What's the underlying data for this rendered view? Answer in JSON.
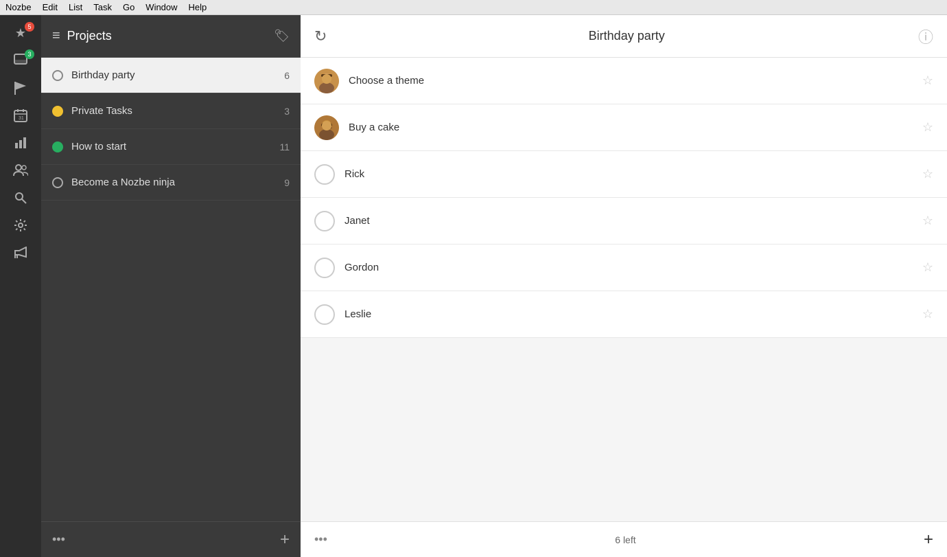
{
  "menubar": {
    "items": [
      "Nozbe",
      "Edit",
      "List",
      "Task",
      "Go",
      "Window",
      "Help"
    ]
  },
  "icon_sidebar": {
    "items": [
      {
        "id": "star",
        "icon": "★",
        "badge": "5",
        "has_badge": true,
        "badge_color": "red"
      },
      {
        "id": "inbox",
        "icon": "⊞",
        "badge": "3",
        "has_badge": true,
        "badge_color": "green"
      },
      {
        "id": "flag",
        "icon": "⚑",
        "has_badge": false
      },
      {
        "id": "calendar",
        "icon": "▦",
        "has_badge": false
      },
      {
        "id": "chart",
        "icon": "▮",
        "has_badge": false
      },
      {
        "id": "team",
        "icon": "👥",
        "has_badge": false
      },
      {
        "id": "search",
        "icon": "🔍",
        "has_badge": false
      },
      {
        "id": "settings",
        "icon": "⚙",
        "has_badge": false
      },
      {
        "id": "megaphone",
        "icon": "📢",
        "has_badge": false
      }
    ]
  },
  "projects_sidebar": {
    "header": {
      "title": "Projects",
      "icon": "≡"
    },
    "projects": [
      {
        "id": "birthday",
        "name": "Birthday party",
        "count": "6",
        "dot_color": "gray",
        "active": true
      },
      {
        "id": "private",
        "name": "Private Tasks",
        "count": "3",
        "dot_color": "yellow",
        "active": false
      },
      {
        "id": "howto",
        "name": "How to start",
        "count": "11",
        "dot_color": "green",
        "active": false
      },
      {
        "id": "ninja",
        "name": "Become a Nozbe ninja",
        "count": "9",
        "dot_color": "light-gray",
        "active": false
      }
    ],
    "footer": {
      "dots_label": "•••",
      "add_label": "+"
    }
  },
  "main_content": {
    "header": {
      "title": "Birthday party",
      "sync_icon": "↻",
      "info_icon": "ℹ"
    },
    "tasks": [
      {
        "id": "choose-theme",
        "name": "Choose a theme",
        "has_avatar": true,
        "avatar_type": "person1",
        "starred": false
      },
      {
        "id": "buy-cake",
        "name": "Buy a cake",
        "has_avatar": true,
        "avatar_type": "person2",
        "starred": false
      },
      {
        "id": "rick",
        "name": "Rick",
        "has_avatar": false,
        "starred": false
      },
      {
        "id": "janet",
        "name": "Janet",
        "has_avatar": false,
        "starred": false
      },
      {
        "id": "gordon",
        "name": "Gordon",
        "has_avatar": false,
        "starred": false
      },
      {
        "id": "leslie",
        "name": "Leslie",
        "has_avatar": false,
        "starred": false
      }
    ],
    "footer": {
      "dots_label": "•••",
      "count_label": "6 left",
      "add_label": "+"
    }
  }
}
